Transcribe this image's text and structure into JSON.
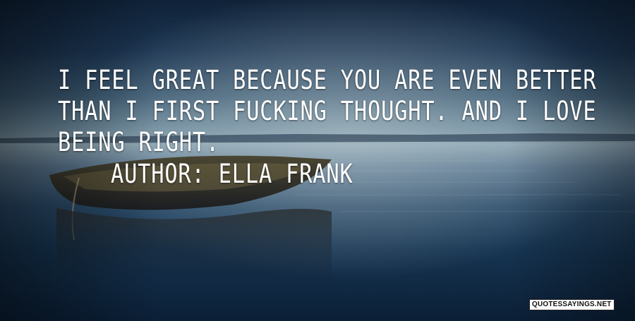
{
  "quote": {
    "lines": [
      "I FEEL GREAT BECAUSE YOU ARE EVEN BETTER",
      "THAN I FIRST FUCKING THOUGHT. AND I LOVE",
      "BEING RIGHT."
    ],
    "author": "AUTHOR: ELLA FRANK"
  },
  "watermark": {
    "text": "QUOTESSAYINGS.NET"
  },
  "colors": {
    "text": "#ffffff",
    "sky_top": "#0f2238",
    "horizon": "#8ba4b2",
    "water_bottom": "#0b1f36"
  }
}
